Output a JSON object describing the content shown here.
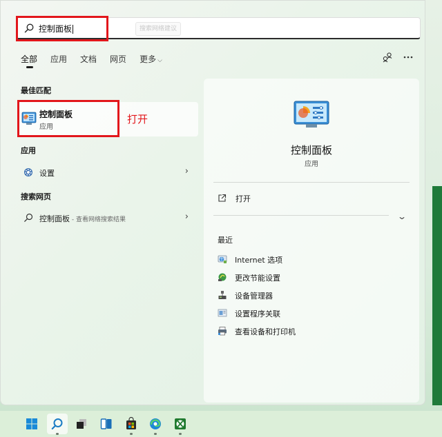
{
  "search": {
    "query": "控制面板",
    "hint_chip": "搜索网络建议"
  },
  "tabs": [
    {
      "label": "全部",
      "active": true
    },
    {
      "label": "应用"
    },
    {
      "label": "文档"
    },
    {
      "label": "网页"
    },
    {
      "label": "更多"
    }
  ],
  "top_icons": [
    "share-network-icon",
    "more-options-icon"
  ],
  "best_match": {
    "section_title": "最佳匹配",
    "name": "控制面板",
    "type": "应用",
    "annotation": "打开"
  },
  "apps": {
    "section_title": "应用",
    "items": [
      {
        "label": "设置",
        "icon": "gear-icon"
      }
    ]
  },
  "web": {
    "section_title": "搜索网页",
    "items": [
      {
        "label": "控制面板",
        "sub": " - 查看网络搜索结果",
        "icon": "search-icon"
      }
    ]
  },
  "detail": {
    "title": "控制面板",
    "type": "应用",
    "open_label": "打开",
    "recent_title": "最近",
    "recent": [
      {
        "label": "Internet 选项",
        "icon": "internet-options-icon"
      },
      {
        "label": "更改节能设置",
        "icon": "power-options-icon"
      },
      {
        "label": "设备管理器",
        "icon": "device-manager-icon"
      },
      {
        "label": "设置程序关联",
        "icon": "file-association-icon"
      },
      {
        "label": "查看设备和打印机",
        "icon": "printer-icon"
      }
    ]
  },
  "taskbar": [
    "windows-start-icon",
    "search-icon",
    "task-view-icon",
    "widgets-icon",
    "store-icon",
    "edge-icon",
    "xbox-icon"
  ],
  "colors": {
    "accent_red": "#e2161b",
    "taskbar_bg": "#dcefd9"
  }
}
